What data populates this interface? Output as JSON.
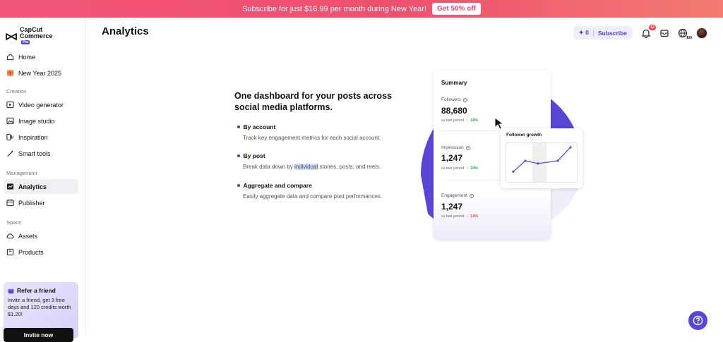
{
  "banner": {
    "text": "Subscribe for just $16.99 per month during New Year!",
    "cta": "Get 50% off"
  },
  "logo": {
    "line1": "CapCut",
    "line2": "Commerce",
    "tag": "Pro"
  },
  "sidebar": {
    "items_top": [
      {
        "label": "Home",
        "icon": "home-icon"
      },
      {
        "label": "New Year 2025",
        "icon": "gift-icon"
      }
    ],
    "section_creation": "Creation",
    "items_creation": [
      {
        "label": "Video generator",
        "icon": "video-plus-icon"
      },
      {
        "label": "Image studio",
        "icon": "image-icon"
      },
      {
        "label": "Inspiration",
        "icon": "inspiration-icon"
      },
      {
        "label": "Smart tools",
        "icon": "magic-wand-icon"
      }
    ],
    "section_management": "Management",
    "items_management": [
      {
        "label": "Analytics",
        "icon": "analytics-icon",
        "active": true
      },
      {
        "label": "Publisher",
        "icon": "calendar-icon"
      }
    ],
    "section_space": "Space",
    "items_space": [
      {
        "label": "Assets",
        "icon": "cloud-icon"
      },
      {
        "label": "Products",
        "icon": "box-icon"
      }
    ],
    "refer": {
      "title": "Refer a friend",
      "text": "Invite a friend, get 3 free days and 120 credits worth $1.20!",
      "button": "Invite now"
    }
  },
  "header": {
    "title": "Analytics",
    "credits": "0",
    "subscribe": "Subscribe",
    "notification_count": "12",
    "language": "EN"
  },
  "main": {
    "headline": "One dashboard for your posts across social media platforms.",
    "features": [
      {
        "title": "By account",
        "desc": "Track key engagement metrics for each social account."
      },
      {
        "title": "By post",
        "desc_before": "Break data down by ",
        "desc_highlight": "individual",
        "desc_after": " stories, posts, and reels."
      },
      {
        "title": "Aggregate and compare",
        "desc": "Easily aggregate data and compare post performances."
      }
    ]
  },
  "summary_card": {
    "title": "Summary",
    "vs_label": "vs last period",
    "metrics": [
      {
        "label": "Followers",
        "value": "88,680",
        "change": "18%",
        "direction": "up"
      },
      {
        "label": "Impression",
        "value": "1,247",
        "change": "34%",
        "direction": "up"
      },
      {
        "label": "Engagement",
        "value": "1,247",
        "change": "14%",
        "direction": "down"
      }
    ]
  },
  "growth_card": {
    "title": "Follower growth",
    "points": [
      1,
      2.6,
      2.2,
      2.6,
      4.6
    ]
  },
  "colors": {
    "accent": "#5646d9",
    "banner": "#ef4f6e",
    "up": "#23a455",
    "down": "#e14a4a"
  }
}
